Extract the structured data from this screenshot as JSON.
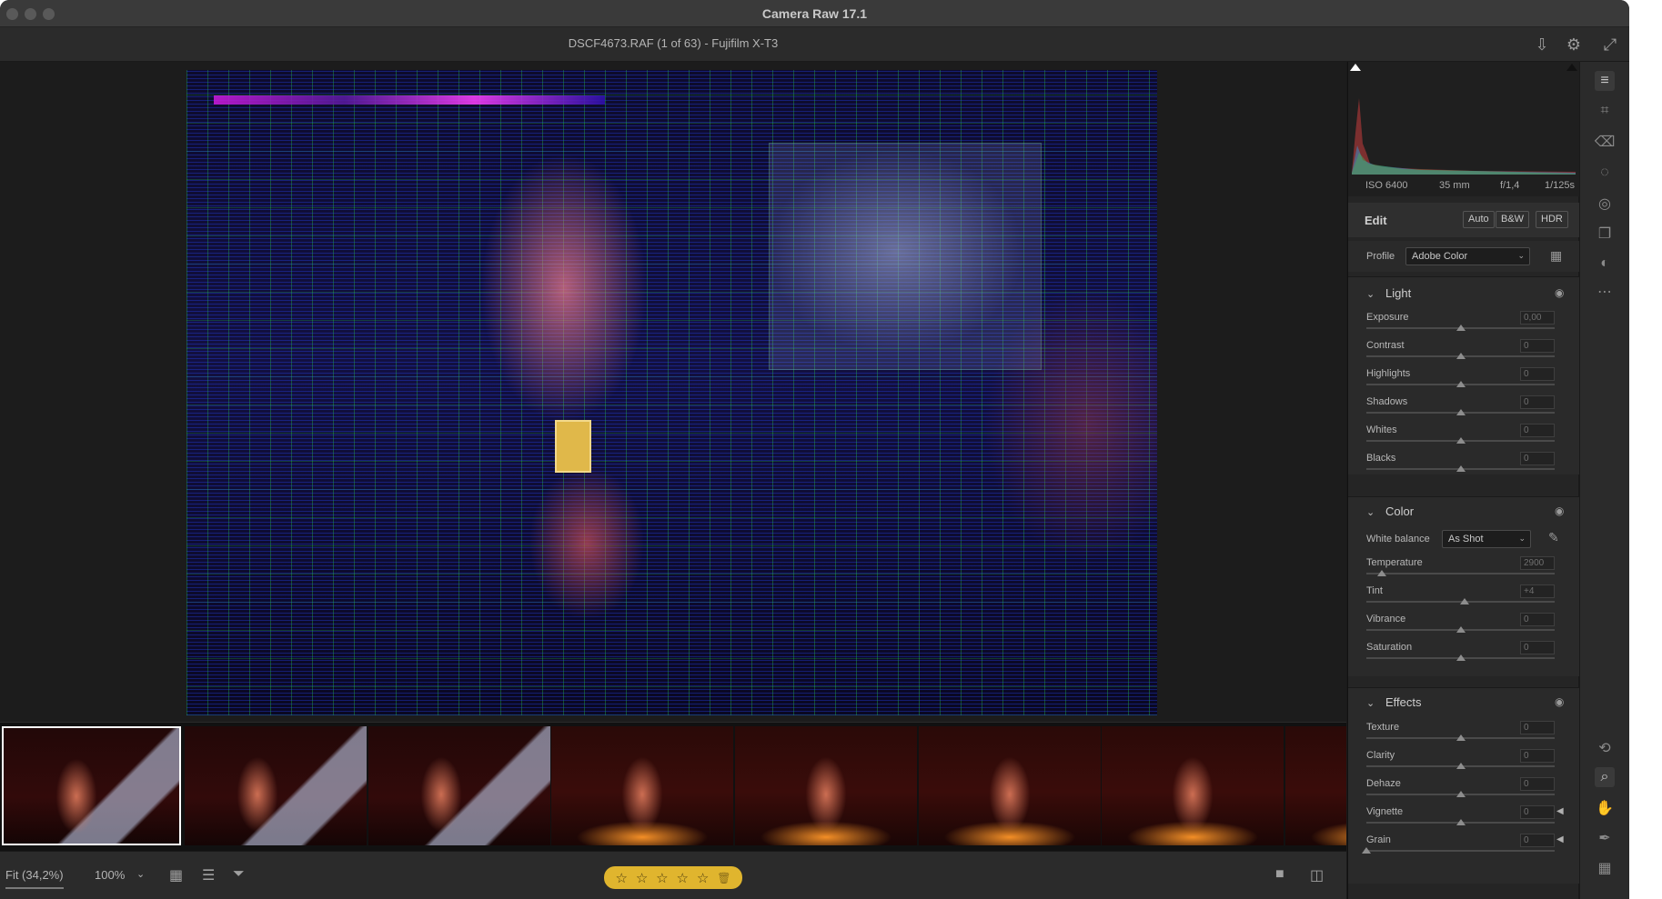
{
  "window": {
    "title": "Camera Raw 17.1",
    "document": "DSCF4673.RAF (1 of 63)  -  Fujifilm X-T3"
  },
  "top_icons": [
    "save-icon",
    "gear-icon",
    "fullscreen-icon"
  ],
  "bottom": {
    "fit": "Fit (34,2%)",
    "zoom": "100%",
    "zoom_caret": "⌄",
    "rating_stars": 0,
    "stars": [
      "☆",
      "☆",
      "☆",
      "☆",
      "☆"
    ],
    "trash_glyph": "🗑"
  },
  "histogram": {
    "iso": "ISO 6400",
    "focal": "35 mm",
    "aperture": "f/1,4",
    "shutter": "1/125s"
  },
  "edit": {
    "title": "Edit",
    "buttons": [
      "Auto",
      "B&W",
      "HDR"
    ],
    "profile_label": "Profile",
    "profile_value": "Adobe Color"
  },
  "light": {
    "title": "Light",
    "sliders": [
      {
        "label": "Exposure",
        "value": "0,00",
        "position": 0.5
      },
      {
        "label": "Contrast",
        "value": "0",
        "position": 0.5
      },
      {
        "label": "Highlights",
        "value": "0",
        "position": 0.5
      },
      {
        "label": "Shadows",
        "value": "0",
        "position": 0.5
      },
      {
        "label": "Whites",
        "value": "0",
        "position": 0.5
      },
      {
        "label": "Blacks",
        "value": "0",
        "position": 0.5
      }
    ]
  },
  "color": {
    "title": "Color",
    "wb_label": "White balance",
    "wb_value": "As Shot",
    "sliders": [
      {
        "label": "Temperature",
        "value": "2900",
        "position": 0.08
      },
      {
        "label": "Tint",
        "value": "+4",
        "position": 0.52
      },
      {
        "label": "Vibrance",
        "value": "0",
        "position": 0.5
      },
      {
        "label": "Saturation",
        "value": "0",
        "position": 0.5
      }
    ]
  },
  "effects": {
    "title": "Effects",
    "sliders": [
      {
        "label": "Texture",
        "value": "0",
        "position": 0.5
      },
      {
        "label": "Clarity",
        "value": "0",
        "position": 0.5
      },
      {
        "label": "Dehaze",
        "value": "0",
        "position": 0.5
      },
      {
        "label": "Vignette",
        "value": "0",
        "position": 0.5
      },
      {
        "label": "Grain",
        "value": "0",
        "position": 0.0
      }
    ]
  },
  "filmstrip": {
    "count": 63,
    "selected_index": 0
  },
  "tools": [
    "edit-sliders-icon",
    "crop-icon",
    "eraser-icon",
    "mask-icon",
    "red-eye-icon",
    "snapshots-icon",
    "presets-icon",
    "more-icon",
    "rotate-icon",
    "zoom-icon",
    "hand-icon",
    "color-sampler-icon",
    "grid-icon"
  ]
}
